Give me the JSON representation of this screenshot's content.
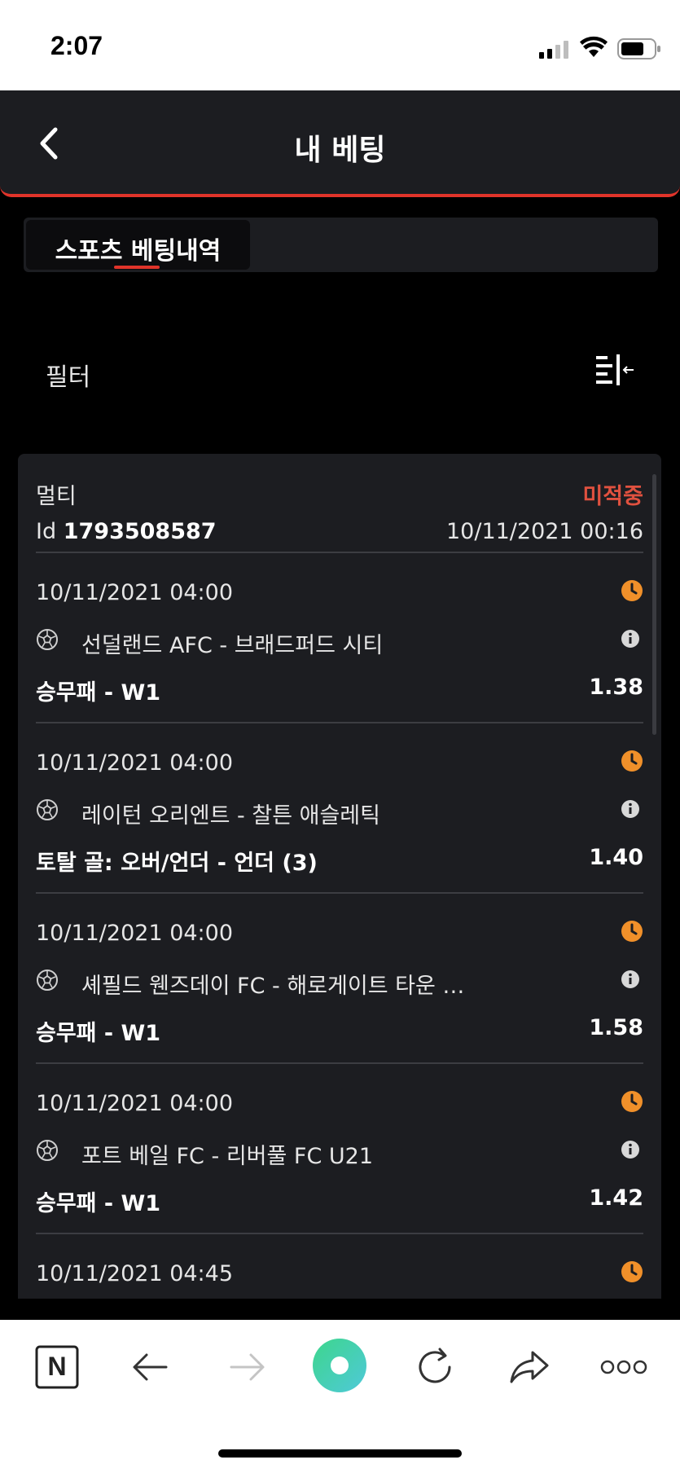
{
  "status": {
    "time": "2:07"
  },
  "header": {
    "title": "내 베팅"
  },
  "tabs": [
    {
      "label": "스포츠 베팅내역"
    }
  ],
  "filter": {
    "label": "필터"
  },
  "bet": {
    "type": "멀티",
    "status": "미적중",
    "id_prefix": "Id",
    "id": "1793508587",
    "date": "10/11/2021 00:16",
    "colors": {
      "accent": "#e0342a",
      "status": "#e0513f",
      "clock": "#f0902a"
    },
    "events": [
      {
        "datetime": "10/11/2021 04:00",
        "match": "선덜랜드 AFC - 브래드퍼드 시티",
        "market": "승무패 - W1",
        "odds": "1.38"
      },
      {
        "datetime": "10/11/2021 04:00",
        "match": "레이턴 오리엔트 - 찰튼 애슬레틱",
        "market": "토탈 골: 오버/언더 - 언더 (3)",
        "odds": "1.40"
      },
      {
        "datetime": "10/11/2021 04:00",
        "match": "셰필드 웬즈데이 FC - 해로게이트 타운 …",
        "market": "승무패 - W1",
        "odds": "1.58"
      },
      {
        "datetime": "10/11/2021 04:00",
        "match": "포트 베일 FC - 리버풀 FC U21",
        "market": "승무패 - W1",
        "odds": "1.42"
      },
      {
        "datetime": "10/11/2021 04:45",
        "match": "",
        "market": "",
        "odds": ""
      }
    ]
  },
  "toolbar": {
    "brand_letter": "N",
    "icons": [
      "naver-icon",
      "back-arrow-icon",
      "forward-arrow-icon",
      "green-dot-icon",
      "reload-icon",
      "share-icon",
      "more-icon"
    ]
  }
}
